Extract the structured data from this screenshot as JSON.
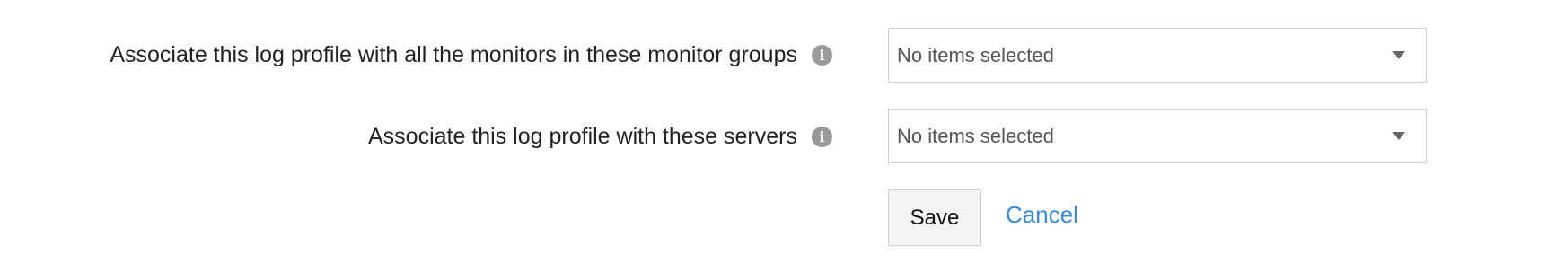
{
  "form": {
    "monitor_groups": {
      "label": "Associate this log profile with all the monitors in these monitor groups",
      "info_icon": "i",
      "selected_value": "No items selected"
    },
    "servers": {
      "label": "Associate this log profile with these servers",
      "info_icon": "i",
      "selected_value": "No items selected"
    }
  },
  "actions": {
    "save_label": "Save",
    "cancel_label": "Cancel"
  },
  "colors": {
    "link": "#3a8bd4",
    "info_icon_bg": "#9a9a9a",
    "border": "#cfcfcf"
  }
}
